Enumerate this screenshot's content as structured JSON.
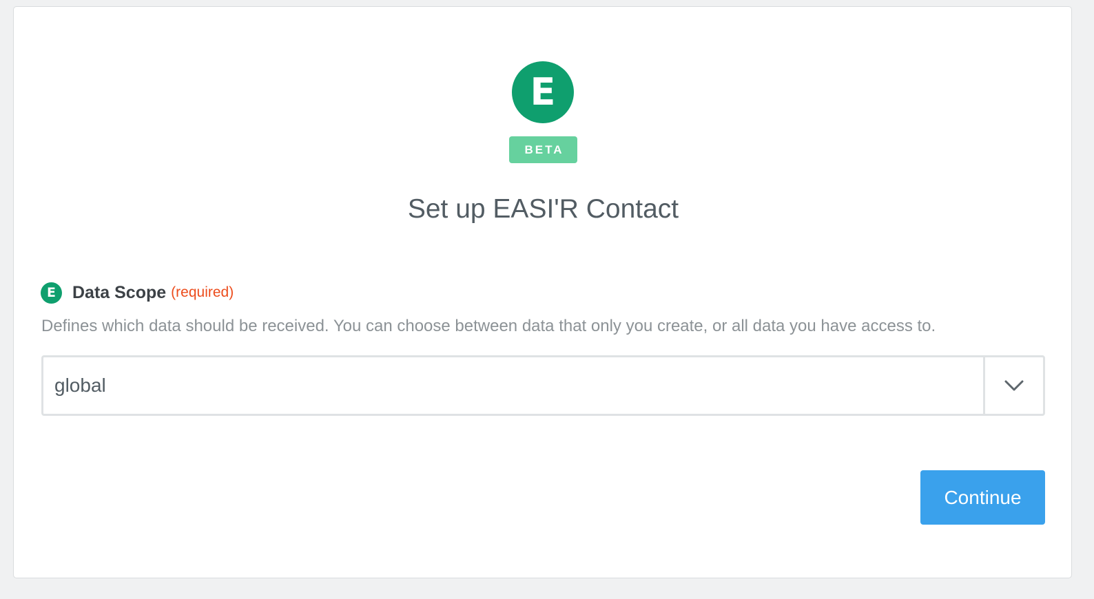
{
  "app": {
    "logo_letter": "E",
    "badge": "BETA",
    "accent_color": "#0f9f6e",
    "badge_color": "#66d19e"
  },
  "page": {
    "title": "Set up EASI'R Contact"
  },
  "field": {
    "icon": "E",
    "label": "Data Scope",
    "required": "(required)",
    "help": "Defines which data should be received. You can choose between data that only you create, or all data you have access to.",
    "value": "global",
    "toggle_icon": "chevron-down-icon"
  },
  "actions": {
    "continue_label": "Continue",
    "continue_color": "#3aa1ec"
  }
}
